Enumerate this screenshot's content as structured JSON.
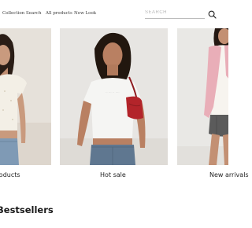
{
  "nav": {
    "links": [
      {
        "label": "Collection"
      },
      {
        "label": "Search"
      },
      {
        "label": "All products"
      },
      {
        "label": "New Look"
      }
    ]
  },
  "search": {
    "placeholder": "SEARCH",
    "icon": "search-icon"
  },
  "collections": [
    {
      "label": "Products"
    },
    {
      "label": "Hot sale"
    },
    {
      "label": "New arrivals"
    }
  ],
  "bestsellers": {
    "title": "Bestsellers"
  },
  "colors": {
    "background": "#ffffff",
    "card_background": "#e8e4de",
    "text": "#1a1a1a",
    "accent_bag": "#b3242a"
  }
}
